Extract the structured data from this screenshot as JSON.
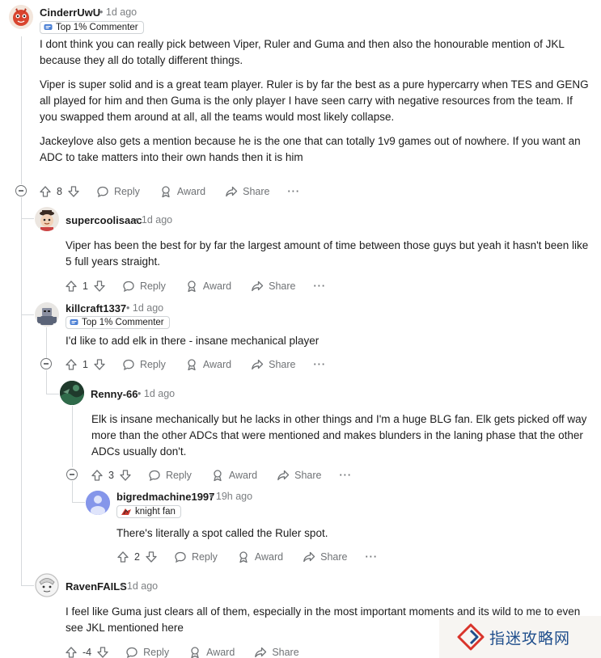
{
  "comments": [
    {
      "username": "CinderrUwU",
      "time": "1d ago",
      "flair": "Top 1% Commenter",
      "paragraphs": [
        "I dont think you can really pick between Viper, Ruler and Guma and then also the honourable mention of JKL because they all do totally different things.",
        "Viper is super solid and is a great team player. Ruler is by far the best as a pure hypercarry when TES and GENG all played for him and then Guma is the only player I have seen carry with negative resources from the team. If you swapped them around at all, all the teams would most likely collapse.",
        "Jackeylove also gets a mention because he is the one that can totally 1v9 games out of nowhere. If you want an ADC to take matters into their own hands then it is him"
      ],
      "votes": "8"
    },
    {
      "username": "supercoolisaac",
      "time": "1d ago",
      "paragraphs": [
        "Viper has been the best for by far the largest amount of time between those guys but yeah it hasn't been like 5 full years straight."
      ],
      "votes": "1"
    },
    {
      "username": "killcraft1337",
      "time": "1d ago",
      "flair": "Top 1% Commenter",
      "paragraphs": [
        "I'd like to add elk in there - insane mechanical player"
      ],
      "votes": "1"
    },
    {
      "username": "Renny-66",
      "time": "1d ago",
      "paragraphs": [
        "Elk is insane mechanically but he lacks in other things and I'm a huge BLG fan. Elk gets picked off way more than the other ADCs that were mentioned and makes blunders in the laning phase that the other ADCs usually don't."
      ],
      "votes": "3"
    },
    {
      "username": "bigredmachine1997",
      "time": "19h ago",
      "flair": "knight fan",
      "paragraphs": [
        "There's literally a spot called the Ruler spot."
      ],
      "votes": "2"
    },
    {
      "username": "RavenFAILS",
      "time": "1d ago",
      "paragraphs": [
        "I feel like Guma just clears all of them, especially in the most important moments and its wild to me to even see JKL mentioned here"
      ],
      "votes": "-4"
    }
  ],
  "actions": {
    "reply": "Reply",
    "award": "Award",
    "share": "Share",
    "more": "···",
    "separator": "•"
  },
  "icons": {
    "upvote": "upvote-icon",
    "downvote": "downvote-icon",
    "reply": "reply-icon",
    "award": "award-icon",
    "share": "share-icon",
    "more": "more-icon",
    "collapse": "collapse-icon"
  },
  "watermark": {
    "text": "指迷攻略网"
  },
  "colors": {
    "text": "#1c1c1c",
    "meta": "#7c7f82",
    "thread_line": "#d6d9dc",
    "watermark_text": "#1f4e8c",
    "watermark_logo": "#d9342b"
  }
}
